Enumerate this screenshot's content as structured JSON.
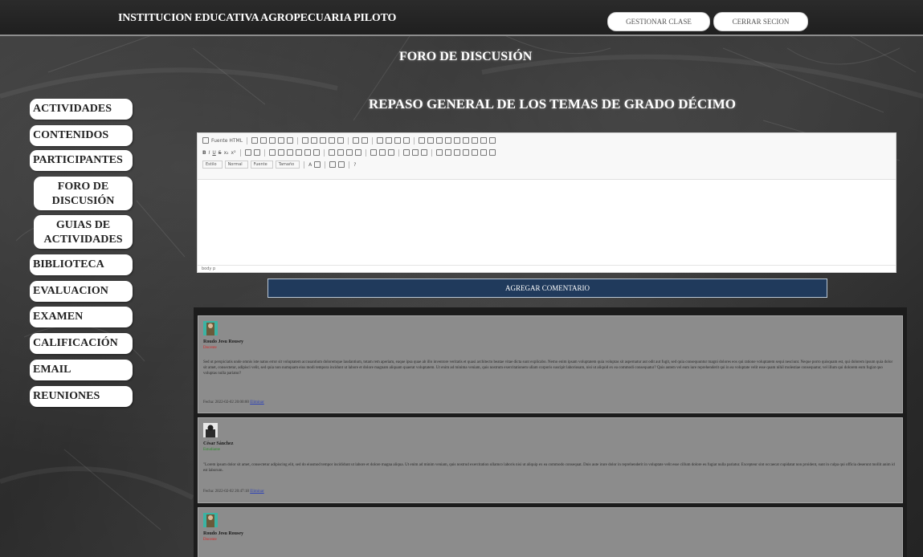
{
  "header": {
    "school_name": "INSTITUCION EDUCATIVA AGROPECUARIA PILOTO",
    "manage_class_label": "GESTIONAR CLASE",
    "logout_label": "CERRAR SECION"
  },
  "page_title": "FORO DE DISCUSIÓN",
  "topic_title": "REPASO GENERAL DE LOS TEMAS DE GRADO DÉCIMO",
  "sidebar": {
    "items": [
      {
        "label": "ACTIVIDADES"
      },
      {
        "label": "CONTENIDOS"
      },
      {
        "label": "PARTICIPANTES"
      },
      {
        "label": "FORO DE DISCUSIÓN"
      },
      {
        "label": "GUIAS DE ACTIVIDADES"
      },
      {
        "label": "BIBLIOTECA"
      },
      {
        "label": "EVALUACION"
      },
      {
        "label": "EXAMEN"
      },
      {
        "label": "CALIFICACIÓN"
      },
      {
        "label": "EMAIL"
      },
      {
        "label": "REUNIONES"
      }
    ]
  },
  "editor": {
    "source_label": "Fuente HTML",
    "style_combo": "Estilo",
    "format_combo": "Normal",
    "font_combo": "Fuente",
    "size_combo": "Tamaño",
    "status_path": "body  p",
    "value": ""
  },
  "add_comment_label": "AGREGAR COMENTARIO",
  "comments": [
    {
      "author": "Roudo Jesu Rousey",
      "role": "Docente",
      "role_color": "#d42424",
      "text": "Sed ut perspiciatis unde omnis iste natus error sit voluptatem accusantium doloremque laudantium, totam rem aperiam, eaque ipsa quae ab illo inventore veritatis et quasi architecto beatae vitae dicta sunt explicabo. Nemo enim ipsam voluptatem quia voluptas sit aspernatur aut odit aut fugit, sed quia consequuntur magni dolores eos qui ratione voluptatem sequi nesciunt. Neque porro quisquam est, qui dolorem ipsum quia dolor sit amet, consectetur, adipisci velit, sed quia non numquam eius modi tempora incidunt ut labore et dolore magnam aliquam quaerat voluptatem. Ut enim ad minima veniam, quis nostrum exercitationem ullam corporis suscipit laboriosam, nisi ut aliquid ex ea commodi consequatur? Quis autem vel eum iure reprehenderit qui in ea voluptate velit esse quam nihil molestiae consequatur, vel illum qui dolorem eum fugiat quo voluptas nulla pariatur?",
      "date": "Fecha: 2022-02-02 20:00:00",
      "delete_label": "Eliminar"
    },
    {
      "author": "César Sánchez",
      "role": "Estudiante",
      "role_color": "#2a8a2a",
      "text": "\"Lorem ipsum dolor sit amet, consectetur adipiscing elit, sed do eiusmod tempor incididunt ut labore et dolore magna aliqua. Ut enim ad minim veniam, quis nostrud exercitation ullamco laboris nisi ut aliquip ex ea commodo consequat. Duis aute irure dolor in reprehenderit in voluptate velit esse cillum dolore eu fugiat nulla pariatur. Excepteur sint occaecat cupidatat non proident, sunt in culpa qui officia deserunt mollit anim id est laborum.",
      "date": "Fecha: 2022-02-02 20:47:18",
      "delete_label": "Eliminar"
    },
    {
      "author": "Roudo Jesu Rousey",
      "role": "Docente",
      "role_color": "#d42424"
    }
  ]
}
